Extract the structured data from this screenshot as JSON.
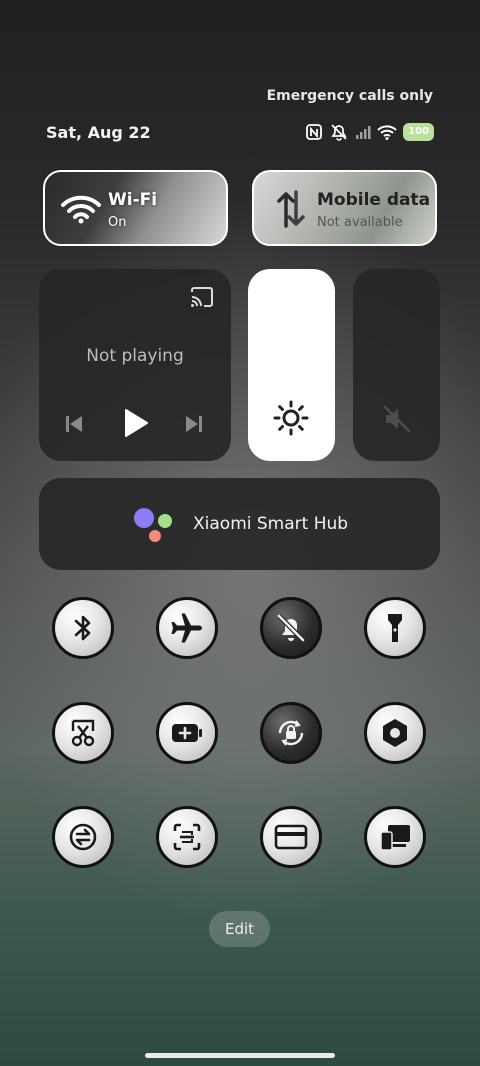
{
  "status": {
    "emergency_text": "Emergency calls only",
    "date": "Sat, Aug 22",
    "battery": "100",
    "icons": [
      "nfc-icon",
      "mute-icon",
      "signal-icon",
      "wifi-icon",
      "battery-icon"
    ]
  },
  "tiles": {
    "wifi": {
      "title": "Wi-Fi",
      "status": "On",
      "icon": "wifi-icon"
    },
    "mobile": {
      "title": "Mobile data",
      "status": "Not available",
      "icon": "data-arrows-icon"
    }
  },
  "media": {
    "status": "Not playing",
    "controls": [
      "cast-icon",
      "previous-icon",
      "play-icon",
      "next-icon"
    ]
  },
  "sliders": {
    "brightness_level": 1.0,
    "volume_level": 0.0,
    "icons": [
      "sun-icon",
      "volume-mute-icon"
    ]
  },
  "hub": {
    "label": "Xiaomi Smart Hub",
    "colors": [
      "#8d7cf7",
      "#a4e08a",
      "#f28b7a"
    ]
  },
  "toggles": [
    {
      "name": "bluetooth",
      "icon": "bluetooth-icon"
    },
    {
      "name": "airplane-mode",
      "icon": "airplane-icon"
    },
    {
      "name": "silent-mode",
      "icon": "bell-off-icon"
    },
    {
      "name": "flashlight",
      "icon": "flashlight-icon"
    },
    {
      "name": "screenshot",
      "icon": "scissors-icon"
    },
    {
      "name": "battery-saver",
      "icon": "battery-plus-icon"
    },
    {
      "name": "rotation-lock",
      "icon": "rotation-lock-icon"
    },
    {
      "name": "settings",
      "icon": "gear-hex-icon"
    },
    {
      "name": "sync",
      "icon": "sync-icon"
    },
    {
      "name": "scanner",
      "icon": "scan-icon"
    },
    {
      "name": "cards",
      "icon": "card-icon"
    },
    {
      "name": "devices",
      "icon": "devices-icon"
    }
  ],
  "edit_label": "Edit"
}
